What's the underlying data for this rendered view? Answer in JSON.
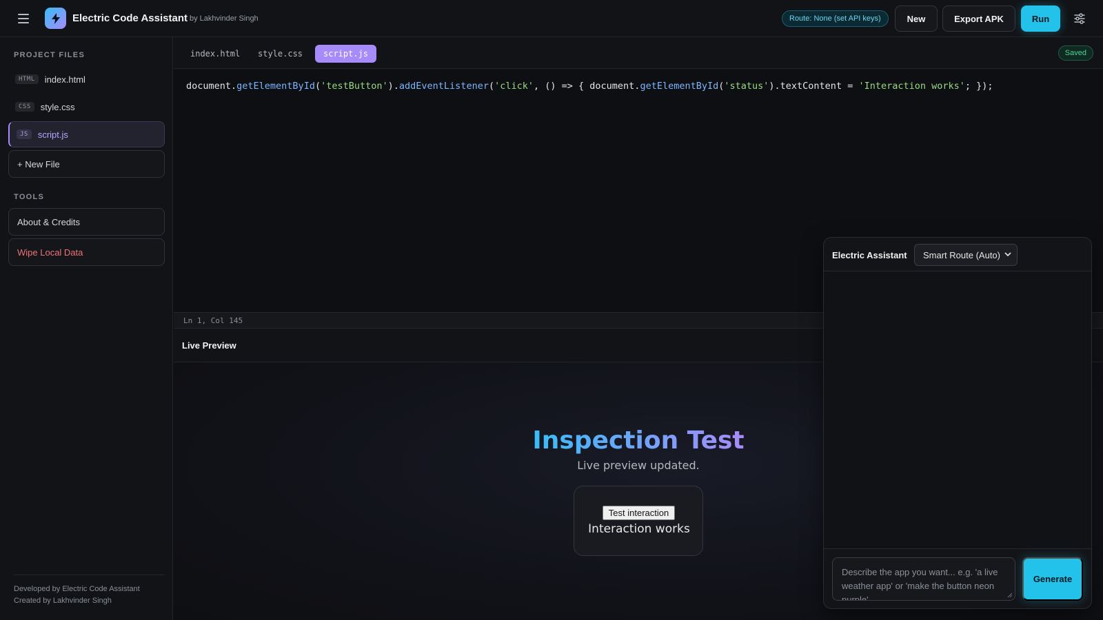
{
  "header": {
    "app_title": "Electric Code Assistant",
    "app_subtitle": "by Lakhvinder Singh",
    "route_badge": "Route: None (set API keys)",
    "new_label": "New",
    "export_label": "Export APK",
    "run_label": "Run"
  },
  "sidebar": {
    "project_files_label": "PROJECT FILES",
    "files": [
      {
        "tag": "HTML",
        "name": "index.html"
      },
      {
        "tag": "CSS",
        "name": "style.css"
      },
      {
        "tag": "JS",
        "name": "script.js",
        "active": true
      }
    ],
    "new_file_label": "+ New File",
    "tools_label": "TOOLS",
    "about_label": "About & Credits",
    "wipe_label": "Wipe Local Data",
    "footer_line1": "Developed by Electric Code Assistant",
    "footer_line2": "Created by Lakhvinder Singh"
  },
  "editor": {
    "tabs": [
      "index.html",
      "style.css",
      "script.js"
    ],
    "active_tab": "script.js",
    "saved_label": "Saved",
    "code": {
      "p1": "document.",
      "f1": "getElementById",
      "p2": "(",
      "s1": "'testButton'",
      "p3": ").",
      "f2": "addEventListener",
      "p4": "(",
      "s2": "'click'",
      "p5": ", () => { document.",
      "f3": "getElementById",
      "p6": "(",
      "s3": "'status'",
      "p7": ").textContent = ",
      "s4": "'Interaction works'",
      "p8": "; });"
    },
    "status": "Ln 1, Col 145"
  },
  "preview": {
    "header_label": "Live Preview",
    "title": "Inspection Test",
    "subtitle": "Live preview updated.",
    "button_label": "Test interaction",
    "status_text": "Interaction works"
  },
  "assistant": {
    "title": "Electric Assistant",
    "route_selected": "Smart Route (Auto)",
    "input_placeholder": "Describe the app you want... e.g. 'a live weather app' or 'make the button neon purple'",
    "generate_label": "Generate"
  },
  "colors": {
    "accent_cyan": "#22c2ea",
    "accent_purple": "#a78bfa",
    "danger": "#f07178",
    "success": "#4fd19a"
  },
  "icons": [
    "menu-icon",
    "bolt-icon",
    "sliders-icon",
    "chevron-down-icon"
  ]
}
